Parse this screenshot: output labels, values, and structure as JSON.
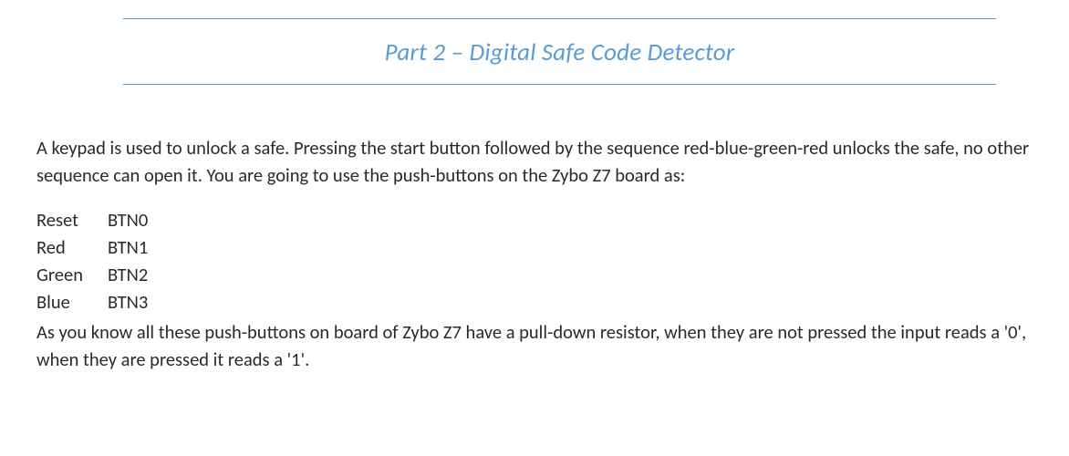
{
  "title": "Part 2 – Digital Safe Code Detector",
  "paragraph1": "A keypad is used to unlock a safe.  Pressing the start button followed by the sequence red-blue-green-red unlocks the safe, no other sequence can open it.  You are going to use the push-buttons on the Zybo Z7 board as:",
  "mapping": [
    {
      "label": "Reset",
      "value": "BTN0"
    },
    {
      "label": "Red",
      "value": "BTN1"
    },
    {
      "label": "Green",
      "value": "BTN2"
    },
    {
      "label": "Blue",
      "value": "BTN3"
    }
  ],
  "paragraph2": "As you know all these push-buttons on board of Zybo Z7 have a pull-down resistor, when they are not pressed the input reads a '0', when they are pressed it reads a '1'."
}
